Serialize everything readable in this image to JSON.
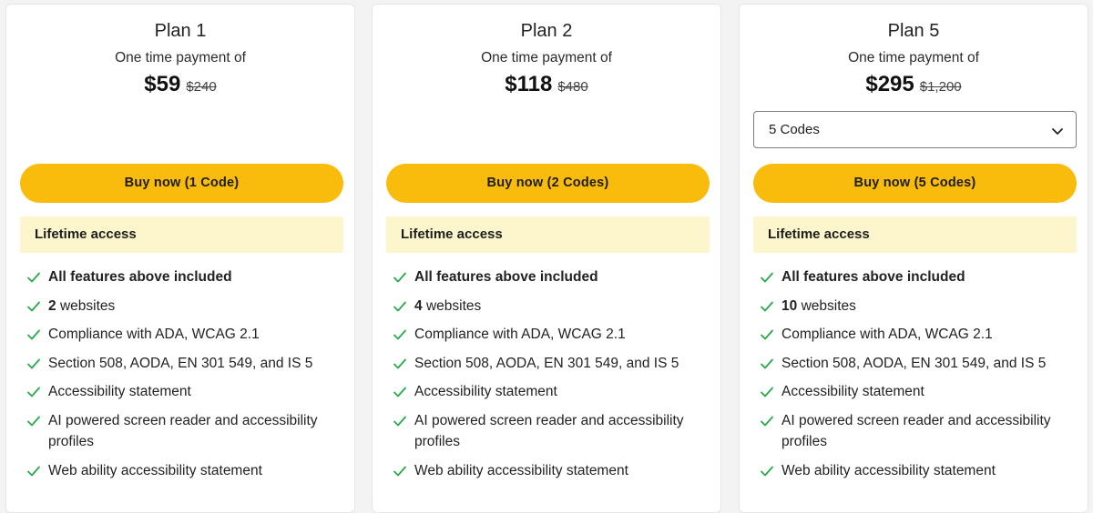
{
  "plans": [
    {
      "title": "Plan 1",
      "subtitle": "One time payment of",
      "price": "$59",
      "old_price": "$240",
      "button": "Buy now (1 Code)",
      "lifetime": "Lifetime access",
      "websites_count": "2",
      "websites_label": "websites"
    },
    {
      "title": "Plan 2",
      "subtitle": "One time payment of",
      "price": "$118",
      "old_price": "$480",
      "button": "Buy now (2 Codes)",
      "lifetime": "Lifetime access",
      "websites_count": "4",
      "websites_label": "websites"
    },
    {
      "title": "Plan 5",
      "subtitle": "One time payment of",
      "price": "$295",
      "old_price": "$1,200",
      "select_value": "5 Codes",
      "button": "Buy now (5 Codes)",
      "lifetime": "Lifetime access",
      "websites_count": "10",
      "websites_label": "websites"
    }
  ],
  "features": {
    "all_included": "All features above included",
    "compliance": "Compliance with ADA, WCAG 2.1",
    "section": "Section 508, AODA, EN 301 549, and IS 5",
    "statement": "Accessibility statement",
    "ai": "AI powered screen reader and accessibility profiles",
    "web_ability": "Web ability accessibility statement"
  },
  "icons": {
    "check": "check-icon",
    "chevron": "chevron-down-icon"
  },
  "colors": {
    "button_bg": "#f9bc0c",
    "lifetime_bg": "#fdf6cc",
    "check": "#2aa84a"
  }
}
